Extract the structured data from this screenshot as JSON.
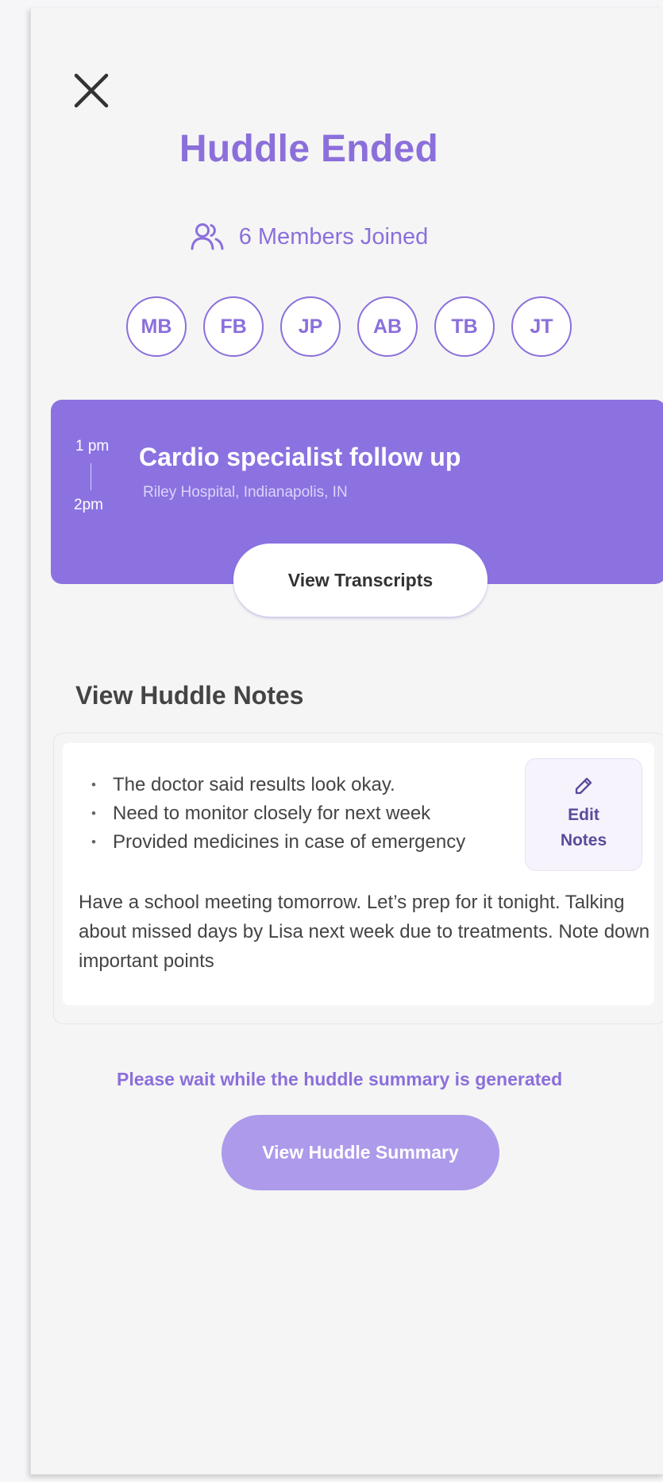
{
  "header": {
    "close_icon": "close-icon",
    "title": "Huddle Ended",
    "members_icon": "users-icon",
    "members_label": "6 Members Joined"
  },
  "members": [
    {
      "initials": "MB"
    },
    {
      "initials": "FB"
    },
    {
      "initials": "JP"
    },
    {
      "initials": "AB"
    },
    {
      "initials": "TB"
    },
    {
      "initials": "JT"
    }
  ],
  "event": {
    "start_time": "1 pm",
    "end_time": "2pm",
    "title": "Cardio specialist follow up",
    "location": "Riley Hospital, Indianapolis, IN",
    "transcripts_button": "View Transcripts"
  },
  "notes": {
    "heading": "View Huddle Notes",
    "bullets": [
      "The doctor said results look okay.",
      "Need to monitor closely for next week",
      "Provided medicines in case of emergency"
    ],
    "paragraph": "Have a school meeting tomorrow. Let’s prep for it tonight. Talking about missed days by Lisa next week due to treatments. Note down important points",
    "edit_icon": "pencil-icon",
    "edit_button_line1": "Edit",
    "edit_button_line2": "Notes"
  },
  "summary": {
    "wait_text": "Please wait while the huddle summary is generated",
    "button_label": "View Huddle Summary"
  },
  "colors": {
    "accent": "#8b6fdb",
    "card": "#8b72e0",
    "summary_button": "#ad9aea"
  }
}
